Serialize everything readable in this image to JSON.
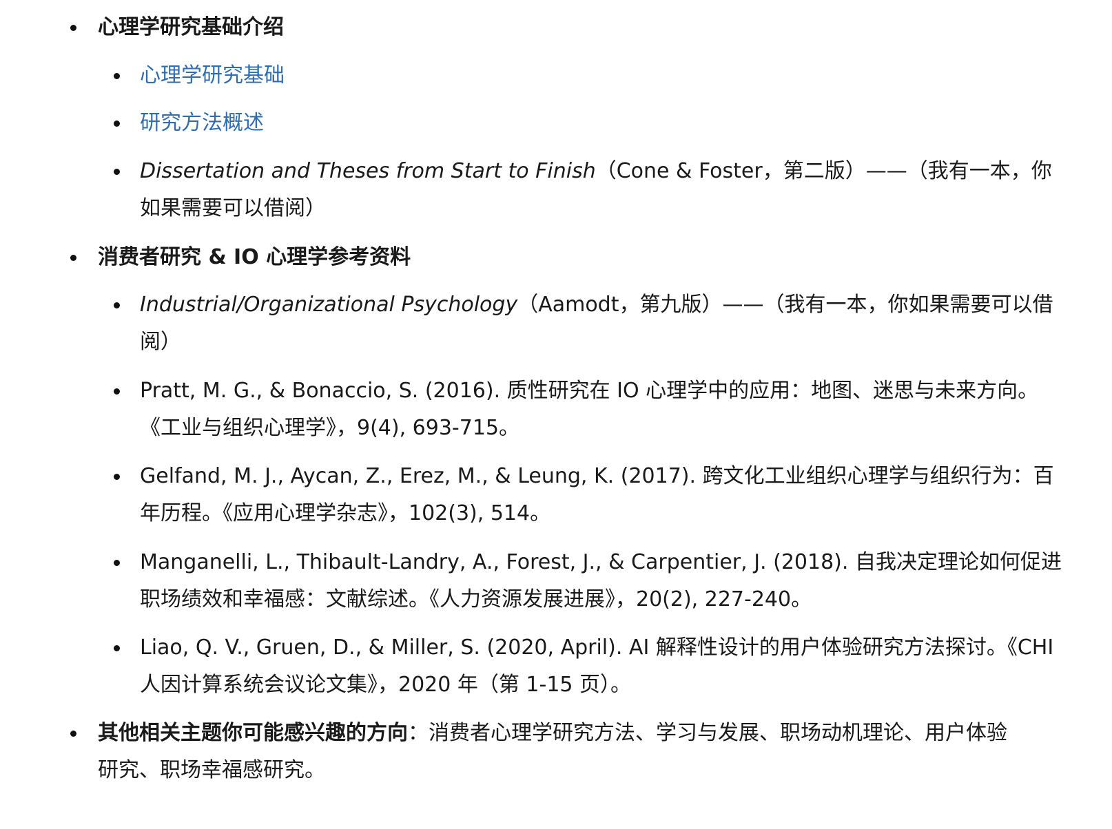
{
  "sections": [
    {
      "heading": "心理学研究基础介绍",
      "items": [
        {
          "link": "心理学研究基础"
        },
        {
          "link": "研究方法概述"
        },
        {
          "title": "Dissertation and Theses from Start to Finish",
          "rest_line1": "（Cone & Foster，第二版）——（我有一本，你",
          "rest_line2": "如果需要可以借阅）"
        }
      ]
    },
    {
      "heading": "消费者研究 & IO 心理学参考资料",
      "items": [
        {
          "title": "Industrial/Organizational Psychology",
          "rest_line1": "（Aamodt，第九版）——（我有一本，你如果需要可以借",
          "rest_line2": "阅）"
        },
        {
          "line1": "Pratt, M. G., & Bonaccio, S. (2016). 质性研究在 IO 心理学中的应用：地图、迷思与未来方向。",
          "line2": "《工业与组织心理学》，9(4), 693-715。"
        },
        {
          "line1": "Gelfand, M. J., Aycan, Z., Erez, M., & Leung, K. (2017). 跨文化工业组织心理学与组织行为：百",
          "line2": "年历程。《应用心理学杂志》，102(3), 514。"
        },
        {
          "line1": "Manganelli, L., Thibault-Landry, A., Forest, J., & Carpentier, J. (2018). 自我决定理论如何促进",
          "line2": "职场绩效和幸福感：文献综述。《人力资源发展进展》，20(2), 227-240。"
        },
        {
          "line1": "Liao, Q. V., Gruen, D., & Miller, S. (2020, April). AI 解释性设计的用户体验研究方法探讨。《CHI",
          "line2": "人因计算系统会议论文集》，2020 年（第 1-15 页）。"
        }
      ]
    },
    {
      "heading": "其他相关主题你可能感兴趣的方向",
      "rest_line1": "：消费者心理学研究方法、学习与发展、职场动机理论、用户体验",
      "rest_line2": "研究、职场幸福感研究。"
    }
  ]
}
